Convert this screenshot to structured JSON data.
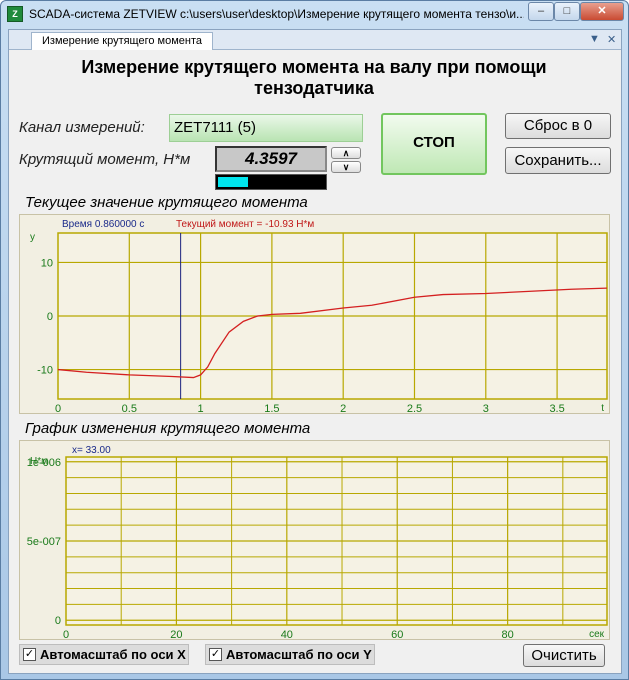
{
  "window": {
    "title": "SCADA-система ZETVIEW c:\\users\\user\\desktop\\Измерение крутящего момента тензо\\и...",
    "icon": "zet-app-icon",
    "min_label": "–",
    "max_label": "□",
    "close_label": "✕"
  },
  "tab": {
    "label": "Измерение крутящего момента",
    "dropdown_icon": "▼",
    "close_icon": "✕"
  },
  "heading": {
    "line1": "Измерение крутящего момента на валу при помощи",
    "line2": "тензодатчика"
  },
  "controls": {
    "channel_label": "Канал измерений:",
    "channel_value": "ZET7111 (5)",
    "torque_label": "Крутящий момент, Н*м",
    "torque_value": "4.3597",
    "level_fraction": 0.28,
    "spin_up": "∧",
    "spin_down": "∨",
    "stop_button": "СТОП",
    "reset_button": "Сброс в 0",
    "save_button": "Сохранить..."
  },
  "chart1_title": "Текущее значение крутящего момента",
  "chart2_title": "График изменения крутящего момента",
  "footer": {
    "autoscale_x": "Автомасштаб по оси X",
    "autoscale_y": "Автомасштаб по оси Y",
    "autoscale_x_checked": true,
    "autoscale_y_checked": true,
    "clear_button": "Очистить"
  },
  "chart_data": [
    {
      "type": "line",
      "title": "",
      "cursor_label": "Время 0.860000 с",
      "value_label": "Текущий момент = -10.93 Н*м",
      "ylabel": "y",
      "xlabel": "t",
      "xlim": [
        0,
        3.85
      ],
      "ylim": [
        -15.5,
        15.5
      ],
      "x_ticks": [
        "0",
        "0.5",
        "1",
        "1.5",
        "2",
        "2.5",
        "3",
        "3.5"
      ],
      "y_ticks": [
        "10",
        "0",
        "-10"
      ],
      "cursor_x": 0.86,
      "grid": true,
      "line_color": "#d42020",
      "axis_color": "#b8a800",
      "series": [
        {
          "x": [
            0,
            0.2,
            0.5,
            0.8,
            0.95,
            1.0,
            1.05,
            1.1,
            1.2,
            1.3,
            1.4,
            1.5,
            1.7,
            2.0,
            2.2,
            2.5,
            2.7,
            3.0,
            3.3,
            3.6,
            3.85
          ],
          "y": [
            -10,
            -10.5,
            -11,
            -11.3,
            -11.5,
            -11,
            -9.5,
            -7,
            -3,
            -1,
            0,
            0.3,
            0.5,
            1.5,
            2,
            3.5,
            4,
            4.2,
            4.6,
            5,
            5.2
          ]
        }
      ]
    },
    {
      "type": "line",
      "title": "",
      "cursor_label": "x=  33.00",
      "ylabel": "Н*м",
      "xlabel": "сек",
      "xlim": [
        0,
        98
      ],
      "ylim": [
        -3e-08,
        1.03e-06
      ],
      "x_ticks": [
        "0",
        "20",
        "40",
        "60",
        "80"
      ],
      "y_ticks": [
        "1e-006",
        "5e-007",
        "0"
      ],
      "grid": true,
      "axis_color": "#b8a800",
      "series": []
    }
  ]
}
